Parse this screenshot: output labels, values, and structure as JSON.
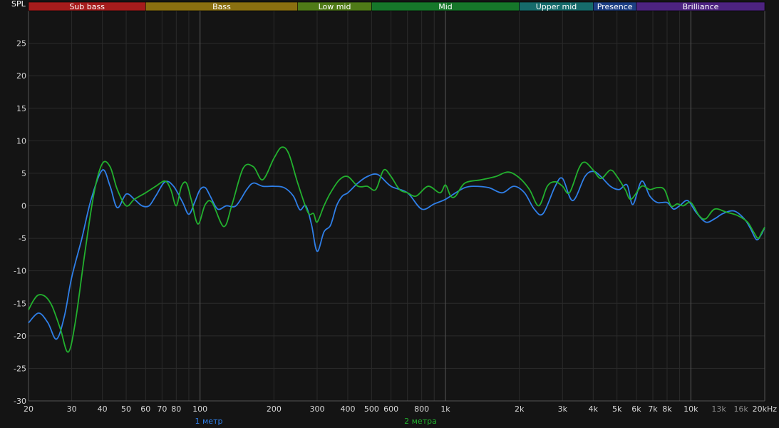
{
  "chart_data": {
    "type": "line",
    "ylabel": "SPL",
    "xscale": "log",
    "xlim": [
      20,
      20000
    ],
    "ylim": [
      -30,
      30
    ],
    "grid": true,
    "legend_placement": "bottom",
    "bands": [
      {
        "label": "Sub bass",
        "from": 20,
        "to": 60,
        "color": "#a51c1c"
      },
      {
        "label": "Bass",
        "from": 60,
        "to": 250,
        "color": "#8a6f10"
      },
      {
        "label": "Low mid",
        "from": 250,
        "to": 500,
        "color": "#4f7a17"
      },
      {
        "label": "Mid",
        "from": 500,
        "to": 2000,
        "color": "#16772a"
      },
      {
        "label": "Upper mid",
        "from": 2000,
        "to": 4000,
        "color": "#166b6b"
      },
      {
        "label": "Presence",
        "from": 4000,
        "to": 6000,
        "color": "#1d3f84"
      },
      {
        "label": "Brilliance",
        "from": 6000,
        "to": 20000,
        "color": "#4d2380"
      }
    ],
    "y_ticks": [
      25,
      20,
      15,
      10,
      5,
      0,
      -5,
      -10,
      -15,
      -20,
      -25,
      -30
    ],
    "x_ticks": [
      {
        "value": 20,
        "label": "20",
        "dim": false
      },
      {
        "value": 30,
        "label": "30",
        "dim": false
      },
      {
        "value": 40,
        "label": "40",
        "dim": false
      },
      {
        "value": 50,
        "label": "50",
        "dim": false
      },
      {
        "value": 60,
        "label": "60",
        "dim": false
      },
      {
        "value": 70,
        "label": "70",
        "dim": false
      },
      {
        "value": 80,
        "label": "80",
        "dim": false
      },
      {
        "value": 100,
        "label": "100",
        "dim": false
      },
      {
        "value": 200,
        "label": "200",
        "dim": false
      },
      {
        "value": 300,
        "label": "300",
        "dim": false
      },
      {
        "value": 400,
        "label": "400",
        "dim": false
      },
      {
        "value": 500,
        "label": "500",
        "dim": false
      },
      {
        "value": 600,
        "label": "600",
        "dim": false
      },
      {
        "value": 800,
        "label": "800",
        "dim": false
      },
      {
        "value": 1000,
        "label": "1k",
        "dim": false
      },
      {
        "value": 2000,
        "label": "2k",
        "dim": false
      },
      {
        "value": 3000,
        "label": "3k",
        "dim": false
      },
      {
        "value": 4000,
        "label": "4k",
        "dim": false
      },
      {
        "value": 5000,
        "label": "5k",
        "dim": false
      },
      {
        "value": 6000,
        "label": "6k",
        "dim": false
      },
      {
        "value": 7000,
        "label": "7k",
        "dim": false
      },
      {
        "value": 8000,
        "label": "8k",
        "dim": false
      },
      {
        "value": 10000,
        "label": "10k",
        "dim": false
      },
      {
        "value": 13000,
        "label": "13k",
        "dim": true
      },
      {
        "value": 16000,
        "label": "16k",
        "dim": true
      },
      {
        "value": 20000,
        "label": "20kHz",
        "dim": false
      }
    ],
    "major_gridlines_x": [
      100,
      1000,
      10000
    ],
    "series": [
      {
        "name": "1 метр",
        "color": "#2f7fe8",
        "points": [
          [
            20,
            -18
          ],
          [
            22,
            -16.5
          ],
          [
            24,
            -18
          ],
          [
            26,
            -20.5
          ],
          [
            28,
            -17
          ],
          [
            30,
            -11
          ],
          [
            33,
            -5
          ],
          [
            36,
            1
          ],
          [
            40,
            5.5
          ],
          [
            43,
            3
          ],
          [
            46,
            -0.3
          ],
          [
            50,
            1.8
          ],
          [
            54,
            1
          ],
          [
            58,
            0
          ],
          [
            62,
            0
          ],
          [
            66,
            1.5
          ],
          [
            72,
            3.7
          ],
          [
            78,
            3
          ],
          [
            85,
            0.5
          ],
          [
            90,
            -1.3
          ],
          [
            95,
            0.5
          ],
          [
            100,
            2.5
          ],
          [
            105,
            2.8
          ],
          [
            110,
            1.5
          ],
          [
            118,
            -0.5
          ],
          [
            128,
            0
          ],
          [
            140,
            0
          ],
          [
            155,
            2.5
          ],
          [
            165,
            3.5
          ],
          [
            180,
            3
          ],
          [
            200,
            3
          ],
          [
            220,
            2.8
          ],
          [
            240,
            1.5
          ],
          [
            255,
            -0.6
          ],
          [
            270,
            0
          ],
          [
            285,
            -3
          ],
          [
            300,
            -7
          ],
          [
            320,
            -4
          ],
          [
            340,
            -3
          ],
          [
            360,
            0
          ],
          [
            380,
            1.5
          ],
          [
            400,
            2
          ],
          [
            440,
            3.5
          ],
          [
            480,
            4.5
          ],
          [
            530,
            4.8
          ],
          [
            600,
            3
          ],
          [
            700,
            2
          ],
          [
            800,
            -0.5
          ],
          [
            900,
            0.3
          ],
          [
            1000,
            1
          ],
          [
            1100,
            2
          ],
          [
            1200,
            2.8
          ],
          [
            1300,
            3
          ],
          [
            1500,
            2.8
          ],
          [
            1700,
            2
          ],
          [
            1900,
            3
          ],
          [
            2100,
            2
          ],
          [
            2300,
            -0.5
          ],
          [
            2500,
            -1.2
          ],
          [
            2800,
            3
          ],
          [
            3000,
            4.2
          ],
          [
            3300,
            0.8
          ],
          [
            3700,
            4.5
          ],
          [
            4000,
            5.3
          ],
          [
            4300,
            4.5
          ],
          [
            4700,
            3
          ],
          [
            5100,
            2.5
          ],
          [
            5500,
            3.2
          ],
          [
            5800,
            0.2
          ],
          [
            6300,
            3.8
          ],
          [
            6800,
            1.5
          ],
          [
            7300,
            0.5
          ],
          [
            8000,
            0.5
          ],
          [
            8500,
            -0.5
          ],
          [
            9000,
            0
          ],
          [
            9700,
            0.8
          ],
          [
            10500,
            -1
          ],
          [
            11500,
            -2.5
          ],
          [
            12500,
            -2
          ],
          [
            13500,
            -1.2
          ],
          [
            15000,
            -0.8
          ],
          [
            16500,
            -2
          ],
          [
            17500,
            -3.5
          ],
          [
            18500,
            -5.2
          ],
          [
            19300,
            -4.5
          ],
          [
            20000,
            -3.3
          ]
        ]
      },
      {
        "name": "2 метра",
        "color": "#22b02e",
        "points": [
          [
            20,
            -16
          ],
          [
            21,
            -14.5
          ],
          [
            22,
            -13.7
          ],
          [
            23.5,
            -14
          ],
          [
            25,
            -15.5
          ],
          [
            27,
            -19
          ],
          [
            29,
            -22.5
          ],
          [
            31,
            -18
          ],
          [
            34,
            -7
          ],
          [
            37,
            2
          ],
          [
            40,
            6.5
          ],
          [
            43,
            6
          ],
          [
            46,
            2.5
          ],
          [
            50,
            0
          ],
          [
            54,
            1
          ],
          [
            60,
            2
          ],
          [
            66,
            3
          ],
          [
            72,
            3.8
          ],
          [
            76,
            2.5
          ],
          [
            80,
            0
          ],
          [
            84,
            3
          ],
          [
            88,
            3.5
          ],
          [
            92,
            1
          ],
          [
            98,
            -2.8
          ],
          [
            105,
            0.2
          ],
          [
            112,
            0.5
          ],
          [
            125,
            -3.2
          ],
          [
            135,
            0.2
          ],
          [
            150,
            5.8
          ],
          [
            165,
            6
          ],
          [
            180,
            4
          ],
          [
            200,
            7.3
          ],
          [
            215,
            9
          ],
          [
            230,
            8
          ],
          [
            250,
            3.5
          ],
          [
            275,
            -1
          ],
          [
            290,
            -1.2
          ],
          [
            300,
            -2.5
          ],
          [
            320,
            0
          ],
          [
            340,
            2
          ],
          [
            370,
            4
          ],
          [
            400,
            4.5
          ],
          [
            440,
            3
          ],
          [
            480,
            3
          ],
          [
            520,
            2.5
          ],
          [
            560,
            5.5
          ],
          [
            600,
            4.5
          ],
          [
            650,
            2.5
          ],
          [
            700,
            2
          ],
          [
            760,
            1.5
          ],
          [
            850,
            3
          ],
          [
            950,
            2
          ],
          [
            1000,
            3.2
          ],
          [
            1050,
            1.5
          ],
          [
            1100,
            1.5
          ],
          [
            1200,
            3.5
          ],
          [
            1400,
            4
          ],
          [
            1600,
            4.5
          ],
          [
            1800,
            5.2
          ],
          [
            2000,
            4.3
          ],
          [
            2200,
            2.5
          ],
          [
            2400,
            0
          ],
          [
            2600,
            3
          ],
          [
            2800,
            3.7
          ],
          [
            3000,
            3
          ],
          [
            3200,
            2
          ],
          [
            3500,
            5.8
          ],
          [
            3700,
            6.7
          ],
          [
            4000,
            5.5
          ],
          [
            4300,
            4.2
          ],
          [
            4700,
            5.5
          ],
          [
            5000,
            4.5
          ],
          [
            5400,
            2.5
          ],
          [
            5700,
            1
          ],
          [
            6300,
            3
          ],
          [
            6800,
            2.5
          ],
          [
            7300,
            2.8
          ],
          [
            7800,
            2.5
          ],
          [
            8300,
            0
          ],
          [
            8800,
            0.3
          ],
          [
            9300,
            0
          ],
          [
            10000,
            0.5
          ],
          [
            10800,
            -1.5
          ],
          [
            11500,
            -2
          ],
          [
            12500,
            -0.5
          ],
          [
            14000,
            -1
          ],
          [
            15500,
            -1.5
          ],
          [
            17000,
            -2.5
          ],
          [
            18000,
            -4
          ],
          [
            18800,
            -5
          ],
          [
            19500,
            -4
          ],
          [
            20000,
            -3.3
          ]
        ]
      }
    ]
  }
}
